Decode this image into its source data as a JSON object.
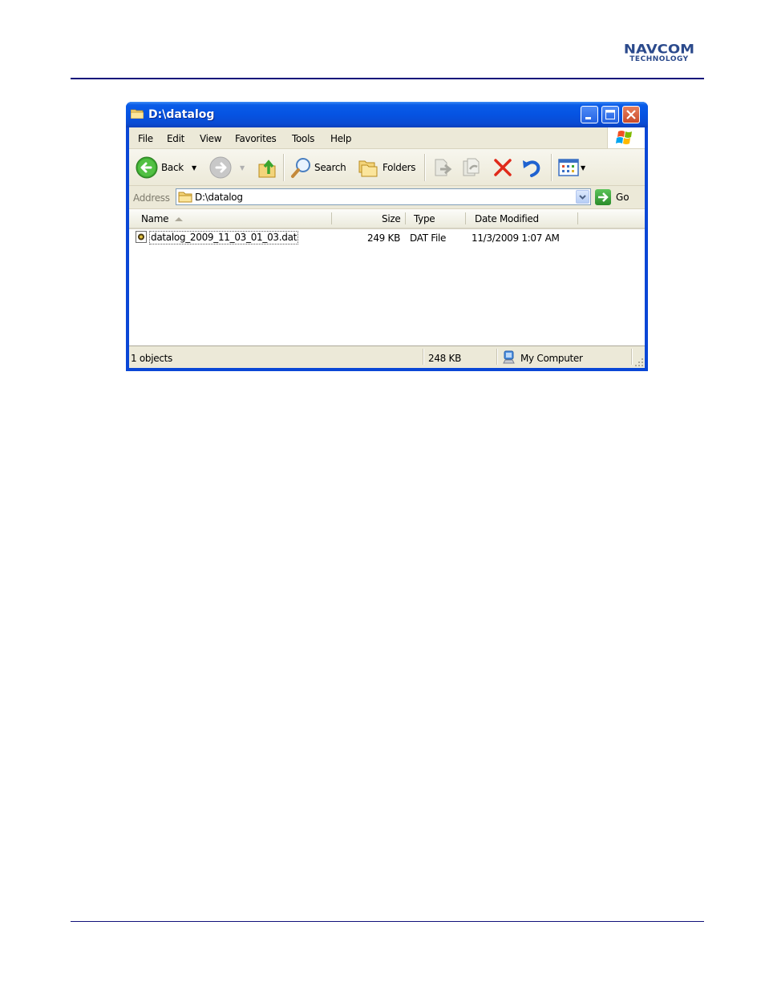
{
  "page": {
    "logo": {
      "line1": "NAVCOM",
      "line2": "TECHNOLOGY"
    }
  },
  "window": {
    "title": "D:\\datalog",
    "title_icon": "folder-icon",
    "controls": [
      "minimize",
      "maximize",
      "close"
    ],
    "menu": [
      "File",
      "Edit",
      "View",
      "Favorites",
      "Tools",
      "Help"
    ],
    "toolbar": {
      "back_label": "Back",
      "search_label": "Search",
      "folders_label": "Folders",
      "icons": [
        "back-icon",
        "forward-icon",
        "up-folder-icon",
        "search-icon",
        "folders-icon",
        "move-to-icon",
        "copy-to-icon",
        "delete-icon",
        "undo-icon",
        "views-icon"
      ]
    },
    "address": {
      "label": "Address",
      "value": "D:\\datalog",
      "go_label": "Go"
    },
    "columns": [
      {
        "label": "Name",
        "sorted": "ascending"
      },
      {
        "label": "Size"
      },
      {
        "label": "Type"
      },
      {
        "label": "Date Modified"
      }
    ],
    "files": [
      {
        "name": "datalog_2009_11_03_01_03.dat",
        "size": "249 KB",
        "type": "DAT File",
        "modified": "11/3/2009 1:07 AM",
        "focused": true
      }
    ],
    "status": {
      "objects": "1 objects",
      "size": "248 KB",
      "location": "My Computer"
    },
    "colors": {
      "titlebar": "#0553e2",
      "chrome": "#ece9d8",
      "close_button": "#d9582f"
    }
  }
}
